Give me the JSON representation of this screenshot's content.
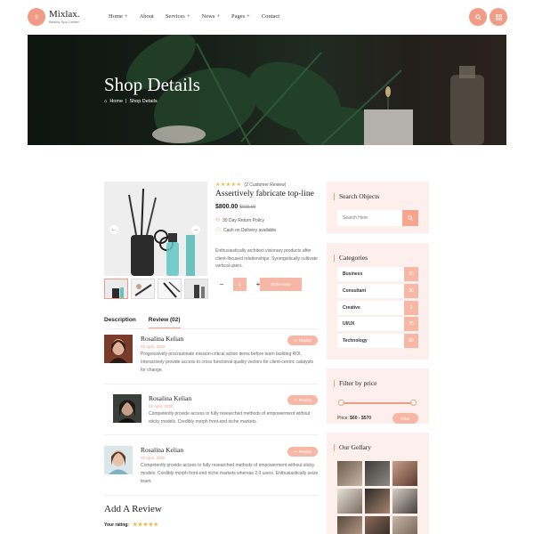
{
  "header": {
    "logo_name": "Mixlax.",
    "logo_tagline": "Beauty Spa Center",
    "nav": [
      {
        "label": "Home",
        "has_sub": true
      },
      {
        "label": "About",
        "has_sub": false
      },
      {
        "label": "Services",
        "has_sub": true
      },
      {
        "label": "News",
        "has_sub": true
      },
      {
        "label": "Pages",
        "has_sub": true
      },
      {
        "label": "Contact",
        "has_sub": false
      }
    ],
    "sub_marker": "+",
    "buttons": [
      "search-icon",
      "grid-menu-icon"
    ]
  },
  "banner": {
    "title": "Shop Details",
    "breadcrumb": {
      "home": "Home",
      "separator": "|",
      "current": "Shop Details"
    }
  },
  "product": {
    "stars": "★★★★★",
    "review_count": "(2 Customer Review)",
    "title": "Assertively fabricate top-line",
    "price": "$800.00",
    "old_price": "$920.00",
    "features": [
      "30 Day Return Policy",
      "Cash on Delivery available"
    ],
    "description": "Enthusiastically architect visionary products after client-focused relationships. Synergistically cultivate vertical users.",
    "quantity": "1",
    "minus": "−",
    "plus": "+",
    "order_label": "Order Now",
    "arrow_prev": "←",
    "arrow_next": "→"
  },
  "tabs": [
    {
      "label": "Description",
      "active": false
    },
    {
      "label": "Review (02)",
      "active": true
    }
  ],
  "reviews": [
    {
      "name": "Rosalina Kelian",
      "date": "02 April, 2020",
      "text": "Progressively procrastinate mission-critical action items before team building ROI. Interactively provide access to cross functional quality vectors for client-centric catalysts for change.",
      "reply": "Replay"
    },
    {
      "name": "Rosalina Kelian",
      "date": "02 April, 2020",
      "text": "Competently provide access to fully researched methods of empowerment without sticky models. Credibly morph front-end niche markets.",
      "reply": "Replay"
    },
    {
      "name": "Rosalina Kelian",
      "date": "02 April, 2020",
      "text": "Competently provide access to fully researched methods of empowerment without sticky models. Credibly morph front-end niche markets whereas 2.0 users. Enthusiastically seize team.",
      "reply": "Replay"
    }
  ],
  "add_review": {
    "title": "Add A Review",
    "rating_label": "Your rating:",
    "stars": "★★★★★"
  },
  "sidebar": {
    "search": {
      "title": "Search Objects",
      "placeholder": "Search Here"
    },
    "categories": {
      "title": "Categories",
      "items": [
        {
          "label": "Business",
          "count": "20"
        },
        {
          "label": "Consultant",
          "count": "30"
        },
        {
          "label": "Creative",
          "count": "3"
        },
        {
          "label": "UI/UX",
          "count": "25"
        },
        {
          "label": "Technology",
          "count": "60"
        }
      ]
    },
    "price_filter": {
      "title": "Filter by price",
      "label": "Price: ",
      "range": "$60 - $570",
      "button": "Filter"
    },
    "gallery": {
      "title": "Our Gellary"
    }
  },
  "colors": {
    "accent": "#f19a86",
    "accent_light": "#f6b7a6",
    "widget_bg": "#fdf0ec",
    "star": "#f2b63c"
  }
}
